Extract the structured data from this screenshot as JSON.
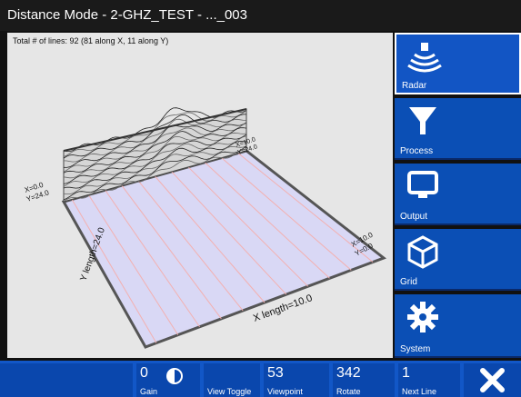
{
  "window": {
    "title": "Distance Mode - 2-GHZ_TEST - ..._003"
  },
  "viewport": {
    "info": "Total # of lines: 92 (81 along X, 11 along Y)",
    "labels": {
      "origin_x": "X=0.0",
      "origin_y": "Y=24.0",
      "back_x": "X=10.0",
      "back_y": "Y=24.0",
      "right_x": "X=10.0",
      "right_y": "Y=0.0",
      "x_length": "X length=10.0",
      "y_length": "Y length=24.0"
    },
    "colors": {
      "grid_fill": "#d9d8f5",
      "grid_line": "#f3b0b0",
      "frame": "#555555"
    }
  },
  "sidebar": {
    "items": [
      {
        "label": "Radar",
        "icon": "radar-icon",
        "active": true
      },
      {
        "label": "Process",
        "icon": "funnel-icon",
        "active": false
      },
      {
        "label": "Output",
        "icon": "monitor-icon",
        "active": false
      },
      {
        "label": "Grid",
        "icon": "cube-icon",
        "active": false
      },
      {
        "label": "System",
        "icon": "gear-icon",
        "active": false
      }
    ]
  },
  "bottombar": {
    "gain": {
      "value": "0",
      "caption": "Gain"
    },
    "view_toggle": {
      "caption": "View Toggle"
    },
    "viewpoint": {
      "value": "53",
      "caption": "Viewpoint"
    },
    "rotate": {
      "value": "342",
      "caption": "Rotate"
    },
    "next_line": {
      "value": "1",
      "caption": "Next Line"
    },
    "close": {
      "icon": "close-icon"
    }
  }
}
